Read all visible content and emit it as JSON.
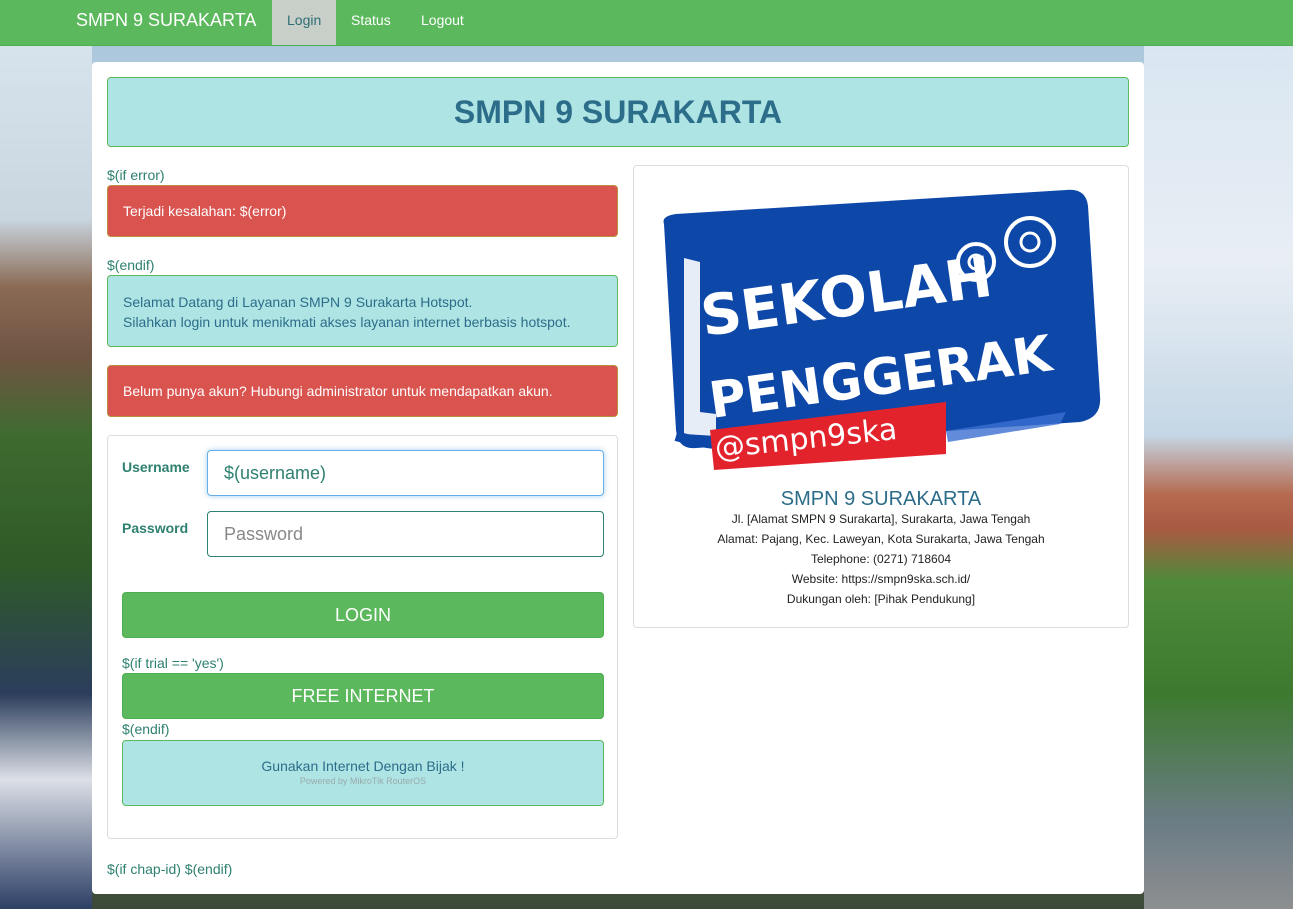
{
  "nav": {
    "brand": "SMPN 9 SURAKARTA",
    "items": [
      {
        "label": "Login"
      },
      {
        "label": "Status"
      },
      {
        "label": "Logout"
      }
    ]
  },
  "header": {
    "title": "SMPN 9 SURAKARTA"
  },
  "left": {
    "if_error": "$(if error)",
    "error_alert": "Terjadi kesalahan: $(error)",
    "endif_1": "$(endif)",
    "welcome_line1": "Selamat Datang di Layanan SMPN 9 Surakarta Hotspot.",
    "welcome_line2": "Silahkan login untuk menikmati akses layanan internet berbasis hotspot.",
    "no_account_alert": "Belum punya akun? Hubungi administrator untuk mendapatkan akun.",
    "chap": "$(if chap-id) $(endif)"
  },
  "form": {
    "username_label": "Username",
    "username_value": "$(username)",
    "password_label": "Password",
    "password_placeholder": "Password",
    "login_button": "LOGIN",
    "if_trial": "$(if trial == 'yes')",
    "free_button": "FREE INTERNET",
    "endif_2": "$(endif)",
    "footer_text": "Gunakan Internet Dengan Bijak !",
    "powered": "Powered by MikroTik RouterOS"
  },
  "logo": {
    "line1": "SEKOLAH",
    "line2": "PENGGERAK",
    "handle": "@smpn9ska"
  },
  "info": {
    "title": "SMPN 9 SURAKARTA",
    "lines": [
      "Jl. [Alamat SMPN 9 Surakarta], Surakarta, Jawa Tengah",
      "Alamat: Pajang, Kec. Laweyan, Kota Surakarta, Jawa Tengah",
      "Telephone: (0271) 718604",
      "Website: https://smpn9ska.sch.id/",
      "Dukungan oleh: [Pihak Pendukung]"
    ]
  },
  "colors": {
    "navbar": "#5cb85c",
    "accent_teal": "#afe4e4",
    "danger": "#d9534f",
    "logo_blue": "#0d47a8",
    "logo_red": "#e3232c"
  }
}
